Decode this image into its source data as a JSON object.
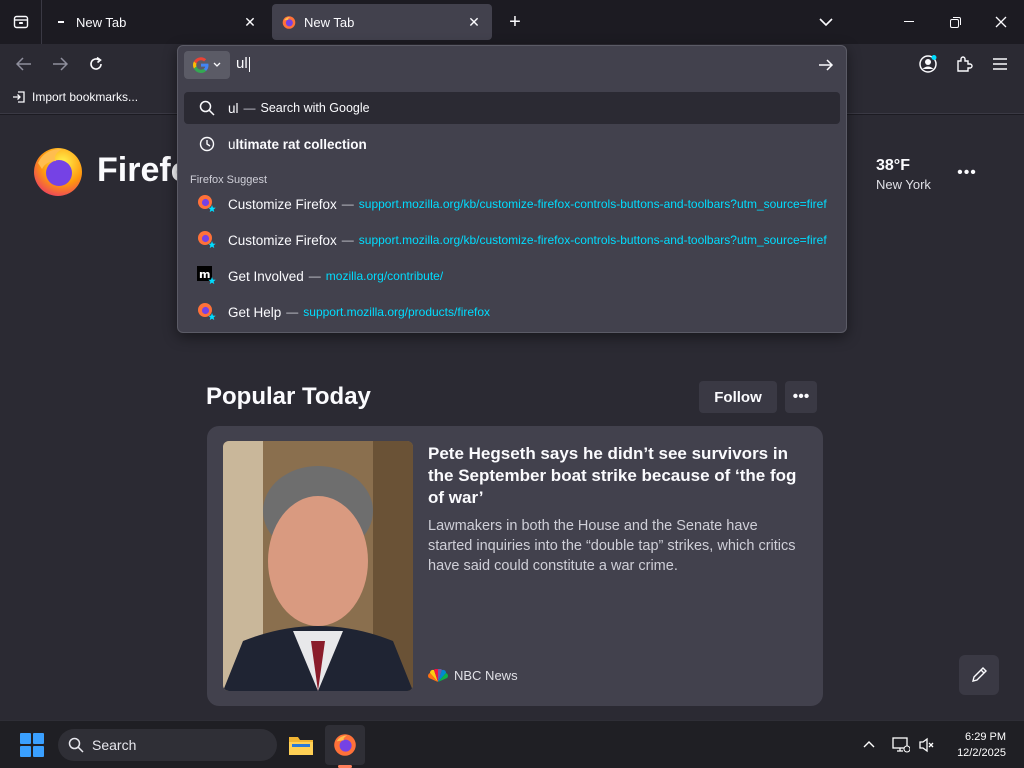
{
  "tabs": [
    {
      "title": "New Tab",
      "active": false
    },
    {
      "title": "New Tab",
      "active": true
    }
  ],
  "toolbar": {
    "import_bookmarks": "Import bookmarks..."
  },
  "urlbar": {
    "typed": "ul",
    "engine": "google",
    "rows": [
      {
        "kind": "search",
        "prefix": "ul",
        "rest": "",
        "sep": "—",
        "hint": "Search with Google"
      },
      {
        "kind": "history",
        "prefix": "u",
        "bold": "ltimate rat collection"
      },
      {
        "kind": "suggest",
        "title_a": "",
        "title_b": "Customize Firefox",
        "sep": "—",
        "url": "support.mozilla.org/kb/customize-firefox-controls-buttons-and-toolbars?utm_source=firef"
      },
      {
        "kind": "suggest",
        "title_a": "C",
        "title_b": "ustomize Firefox",
        "sep": "—",
        "url": "support.mozilla.org/kb/customize-firefox-controls-buttons-and-toolbars?utm_source=firef"
      },
      {
        "kind": "suggest",
        "title": "Get Involved",
        "sep": "—",
        "url": "mozilla.org/contribute/"
      },
      {
        "kind": "suggest",
        "title": "Get Help",
        "sep": "—",
        "url": "support.mozilla.org/products/firefox"
      }
    ],
    "group_label": "Firefox Suggest"
  },
  "newtab": {
    "wordmark": "Firefo",
    "weather": {
      "temp": "38°F",
      "city": "New York"
    },
    "section_title": "Popular Today",
    "follow_label": "Follow",
    "story": {
      "title": "Pete Hegseth says he didn’t see survivors in the September boat strike because of ‘the fog of war’",
      "desc": "Lawmakers in both the House and the Senate have started inquiries into the “double tap” strikes, which critics have said could constitute a war crime.",
      "source": "NBC News"
    }
  },
  "taskbar": {
    "search_label": "Search",
    "time": "6:29 PM",
    "date": "12/2/2025"
  },
  "colors": {
    "accent": "#00ddff",
    "bg": "#2b2a33",
    "panel": "#42414d"
  }
}
